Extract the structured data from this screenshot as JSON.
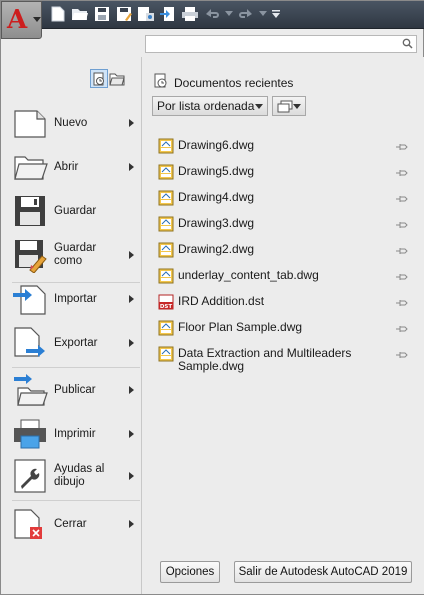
{
  "qat": {
    "app_icon": "autocad-logo-icon",
    "logo_letter": "A",
    "icons": [
      "new-icon",
      "open-icon",
      "save-icon",
      "save-as-icon",
      "open-from-web-icon",
      "save-to-web-icon",
      "plot-icon",
      "undo-icon",
      "redo-icon",
      "customize-qat-icon"
    ]
  },
  "search": {
    "value": "",
    "placeholder": ""
  },
  "left_menu": {
    "items": [
      {
        "label": "Nuevo",
        "icon": "new-document-icon",
        "has_submenu": true
      },
      {
        "label": "Abrir",
        "icon": "open-folder-icon",
        "has_submenu": true
      },
      {
        "label": "Guardar",
        "icon": "floppy-disk-icon",
        "has_submenu": false
      },
      {
        "label": "Guardar como",
        "icon": "save-as-icon",
        "has_submenu": true
      },
      {
        "label": "Importar",
        "icon": "import-icon",
        "has_submenu": true
      },
      {
        "label": "Exportar",
        "icon": "export-icon",
        "has_submenu": true
      },
      {
        "label": "Publicar",
        "icon": "publish-icon",
        "has_submenu": true
      },
      {
        "label": "Imprimir",
        "icon": "printer-icon",
        "has_submenu": true
      },
      {
        "label": "Ayudas al dibujo",
        "icon": "wrench-icon",
        "has_submenu": true
      },
      {
        "label": "Cerrar",
        "icon": "close-document-icon",
        "has_submenu": true
      }
    ]
  },
  "right_panel": {
    "title": "Documentos recientes",
    "sort_label": "Por lista ordenada",
    "files": [
      {
        "name": "Drawing6.dwg",
        "type": "dwg"
      },
      {
        "name": "Drawing5.dwg",
        "type": "dwg"
      },
      {
        "name": "Drawing4.dwg",
        "type": "dwg"
      },
      {
        "name": "Drawing3.dwg",
        "type": "dwg"
      },
      {
        "name": "Drawing2.dwg",
        "type": "dwg"
      },
      {
        "name": "underlay_content_tab.dwg",
        "type": "dwg"
      },
      {
        "name": "IRD Addition.dst",
        "type": "dst"
      },
      {
        "name": "Floor Plan Sample.dwg",
        "type": "dwg"
      },
      {
        "name": "Data Extraction and Multileaders Sample.dwg",
        "type": "dwg"
      }
    ]
  },
  "footer": {
    "options_label": "Opciones",
    "exit_label": "Salir de Autodesk AutoCAD 2019"
  },
  "colors": {
    "qat_bg": "#3b4450",
    "panel_bg": "#ececec",
    "logo_red": "#cc1e1e",
    "active_toggle": "#cfe3f7"
  }
}
